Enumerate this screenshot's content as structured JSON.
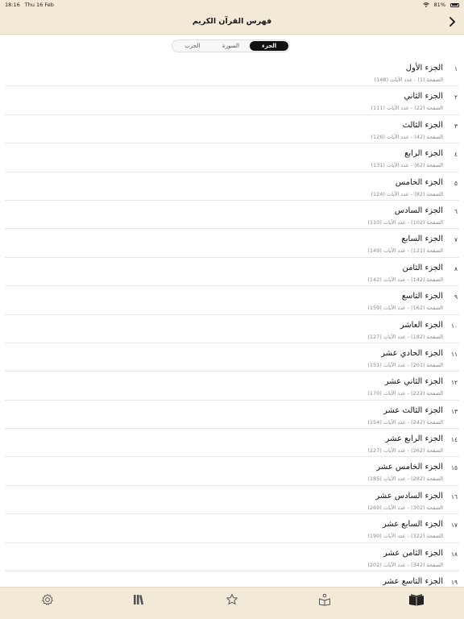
{
  "status": {
    "time": "18:16",
    "date": "Thu 16 Feb",
    "battery": "81%"
  },
  "header": {
    "title": "فهرس القرآن الكريم"
  },
  "segments": [
    {
      "label": "الجزء",
      "active": true
    },
    {
      "label": "السورة",
      "active": false
    },
    {
      "label": "الحزب",
      "active": false
    }
  ],
  "juz": [
    {
      "num": "١",
      "title": "الجزء الأول",
      "sub": "الصفحة (1) - عدد الآيات (148)"
    },
    {
      "num": "٢",
      "title": "الجزء الثاني",
      "sub": "الصفحة (22) - عدد الآيات (111)"
    },
    {
      "num": "٣",
      "title": "الجزء الثالث",
      "sub": "الصفحة (42) - عدد الآيات (126)"
    },
    {
      "num": "٤",
      "title": "الجزء الرابع",
      "sub": "الصفحة (62) - عدد الآيات (131)"
    },
    {
      "num": "٥",
      "title": "الجزء الخامس",
      "sub": "الصفحة (82) - عدد الآيات (124)"
    },
    {
      "num": "٦",
      "title": "الجزء السادس",
      "sub": "الصفحة (102) - عدد الآيات (110)"
    },
    {
      "num": "٧",
      "title": "الجزء السابع",
      "sub": "الصفحة (121) - عدد الآيات (149)"
    },
    {
      "num": "٨",
      "title": "الجزء الثامن",
      "sub": "الصفحة (142) - عدد الآيات (142)"
    },
    {
      "num": "٩",
      "title": "الجزء التاسع",
      "sub": "الصفحة (162) - عدد الآيات (159)"
    },
    {
      "num": "١٠",
      "title": "الجزء العاشر",
      "sub": "الصفحة (182) - عدد الآيات (127)"
    },
    {
      "num": "١١",
      "title": "الجزء الحادي عشر",
      "sub": "الصفحة (201) - عدد الآيات (151)"
    },
    {
      "num": "١٢",
      "title": "الجزء الثاني عشر",
      "sub": "الصفحة (222) - عدد الآيات (170)"
    },
    {
      "num": "١٣",
      "title": "الجزء الثالث عشر",
      "sub": "الصفحة (242) - عدد الآيات (154)"
    },
    {
      "num": "١٤",
      "title": "الجزء الرابع عشر",
      "sub": "الصفحة (262) - عدد الآيات (227)"
    },
    {
      "num": "١٥",
      "title": "الجزء الخامس عشر",
      "sub": "الصفحة (282) - عدد الآيات (185)"
    },
    {
      "num": "١٦",
      "title": "الجزء السادس عشر",
      "sub": "الصفحة (302) - عدد الآيات (269)"
    },
    {
      "num": "١٧",
      "title": "الجزء السابع عشر",
      "sub": "الصفحة (322) - عدد الآيات (190)"
    },
    {
      "num": "١٨",
      "title": "الجزء الثامن عشر",
      "sub": "الصفحة (342) - عدد الآيات (202)"
    },
    {
      "num": "١٩",
      "title": "الجزء التاسع عشر",
      "sub": ""
    }
  ],
  "tabs": [
    {
      "icon": "gear-icon"
    },
    {
      "icon": "library-icon"
    },
    {
      "icon": "star-icon"
    },
    {
      "icon": "reader-icon"
    },
    {
      "icon": "quran-index-icon"
    }
  ]
}
